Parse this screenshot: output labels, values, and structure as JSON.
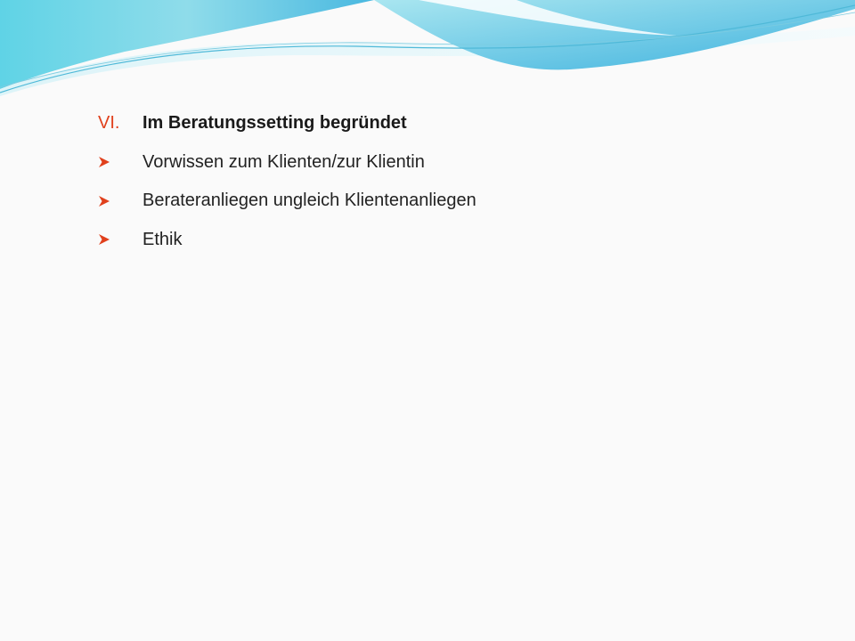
{
  "slide": {
    "accent_color": "#e0401c",
    "heading": {
      "number": "VI.",
      "text": "Im Beratungssetting begründet"
    },
    "items": [
      {
        "icon": "arrow-bullet-icon",
        "text": "Vorwissen zum Klienten/zur Klientin"
      },
      {
        "icon": "arrow-bullet-icon",
        "text": "Berateranliegen ungleich Klientenanliegen"
      },
      {
        "icon": "arrow-bullet-icon",
        "text": "Ethik"
      }
    ]
  }
}
